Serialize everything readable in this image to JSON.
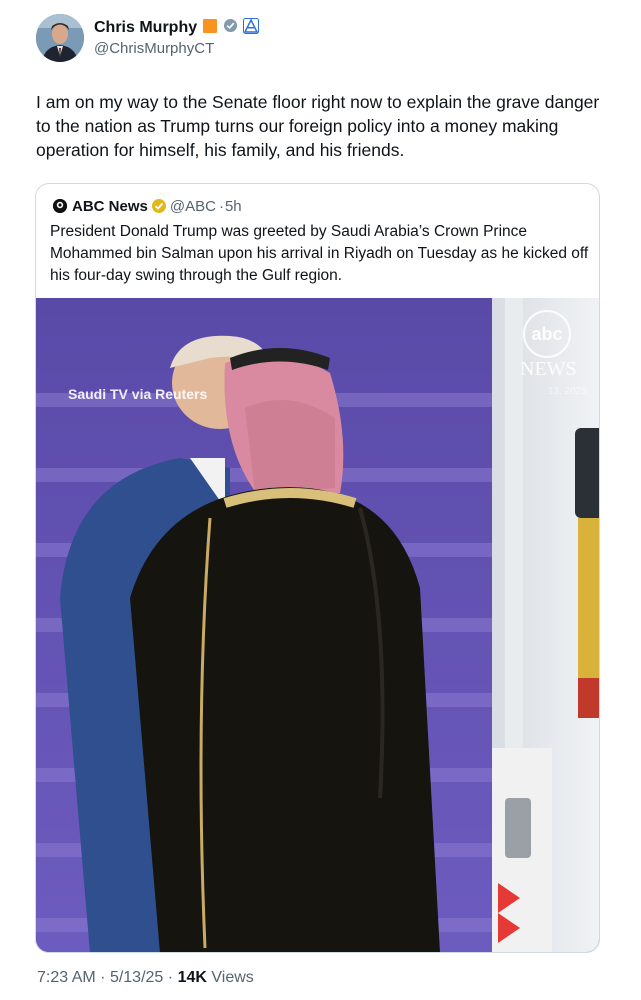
{
  "author": {
    "display_name": "Chris Murphy",
    "handle": "@ChrisMurphyCT",
    "avatar_icon": "avatar-photo",
    "badges": [
      "flag-badge",
      "verified-gray-icon",
      "party-badge"
    ]
  },
  "tweet": {
    "text": "I am on my way to the Senate floor right now to explain the grave danger to the nation as Trump turns our foreign policy into a money making operation for himself, his family, and his friends."
  },
  "quote": {
    "name": "ABC News",
    "handle": "@ABC",
    "separator": "·",
    "age": "5h",
    "text": "President Donald Trump was greeted by Saudi Arabia’s Crown Prince Mohammed bin Salman upon his arrival in Riyadh on Tuesday as he kicked off his four-day swing through the Gulf region.",
    "logo_text": "NEWS",
    "media": {
      "source_caption": "Saudi TV via Reuters",
      "abc_logo": "abc",
      "news_logo": "NEWS",
      "date_fragment": "13, 2025"
    }
  },
  "footer": {
    "time": "7:23 AM",
    "dot": "·",
    "date": "5/13/25",
    "dot2": "·",
    "views_count": "14K",
    "views_label": "Views"
  },
  "colors": {
    "verified_gold": "#e2b719",
    "text_primary": "#0f1419",
    "text_secondary": "#536471",
    "border": "#cfd9de"
  }
}
